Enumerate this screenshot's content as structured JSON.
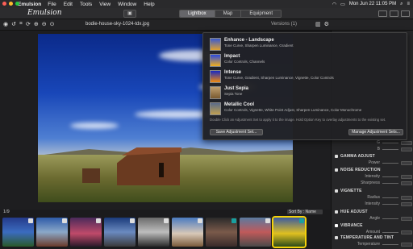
{
  "menubar": {
    "app_name": "Emulsion",
    "items": [
      "File",
      "Edit",
      "Tools",
      "View",
      "Window",
      "Help"
    ],
    "clock": "Mon Jun 22  11:05 PM"
  },
  "titlebar": {
    "logo": "Emulsion",
    "modes": [
      "Lightbox",
      "Map",
      "Equipment"
    ],
    "active_mode": "Lightbox"
  },
  "toolbar": {
    "filename": "bodie-house-sky-1024-tdx.jpg",
    "versions": "Versions (1)"
  },
  "presets": [
    {
      "name": "Enhance - Landscape",
      "desc": "Tone Curve, Sharpen Luminance, Gradient"
    },
    {
      "name": "Impact",
      "desc": "Color Controls, Channels"
    },
    {
      "name": "Intense",
      "desc": "Tone Curve, Gradient, Sharpen Luminance, Vignette, Color Controls"
    },
    {
      "name": "Just Sepia",
      "desc": "Sepia Tone"
    },
    {
      "name": "Metallic Cool",
      "desc": "Color Controls, Vignette, White Point Adjust, Sharpen Luminance, Color Monochrome"
    }
  ],
  "dropdown": {
    "hint": "Double Click an Adjustment Set to apply it to the image. Hold Option Key to overlay adjustments to the existing set.",
    "save_label": "Save Adjustment Set...",
    "manage_label": "Manage Adjustment Sets..."
  },
  "panel": {
    "g_label": "G",
    "b_label": "B",
    "gamma": "GAMMA ADJUST",
    "power": "Power",
    "noise": "NOISE REDUCTION",
    "intensity": "Intensity",
    "sharpness": "Sharpness",
    "vignette": "VIGNETTE",
    "radius": "Radius",
    "intensity2": "Intensity",
    "hue": "HUE ADJUST",
    "angle": "Angle",
    "vibrance": "VIBRANCE",
    "amount": "Amount",
    "temp": "TEMPERATURE AND TINT",
    "temperature": "Temperature"
  },
  "filmstrip": {
    "count": "1/9",
    "sort": "Sort By : Name"
  },
  "colors": {
    "accent_selection": "#f4d20a",
    "menubar_bg": "#2a2a2c"
  }
}
